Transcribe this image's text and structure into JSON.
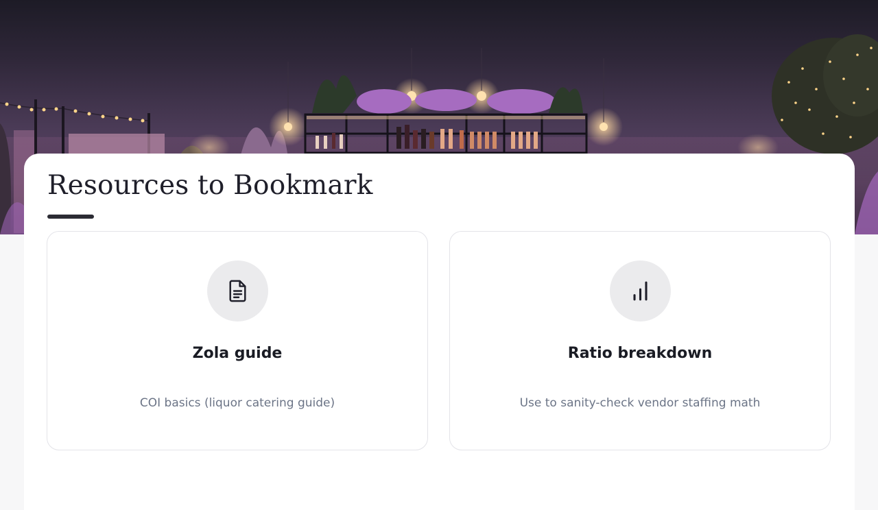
{
  "hero": {
    "scene": "evening-bar-banner"
  },
  "section": {
    "title": "Resources to Bookmark"
  },
  "resources": [
    {
      "icon": "document-icon",
      "title": "Zola guide",
      "description": "COI basics (liquor catering guide)"
    },
    {
      "icon": "bar-chart-icon",
      "title": "Ratio breakdown",
      "description": "Use to sanity-check vendor staffing math"
    }
  ],
  "colors": {
    "page_background": "#f7f7f8",
    "card_background": "#ffffff",
    "title_text": "#1f1f2a",
    "description_text": "#6b7486",
    "icon_circle": "#ebebed",
    "accent_underline": "#2b2b33"
  }
}
